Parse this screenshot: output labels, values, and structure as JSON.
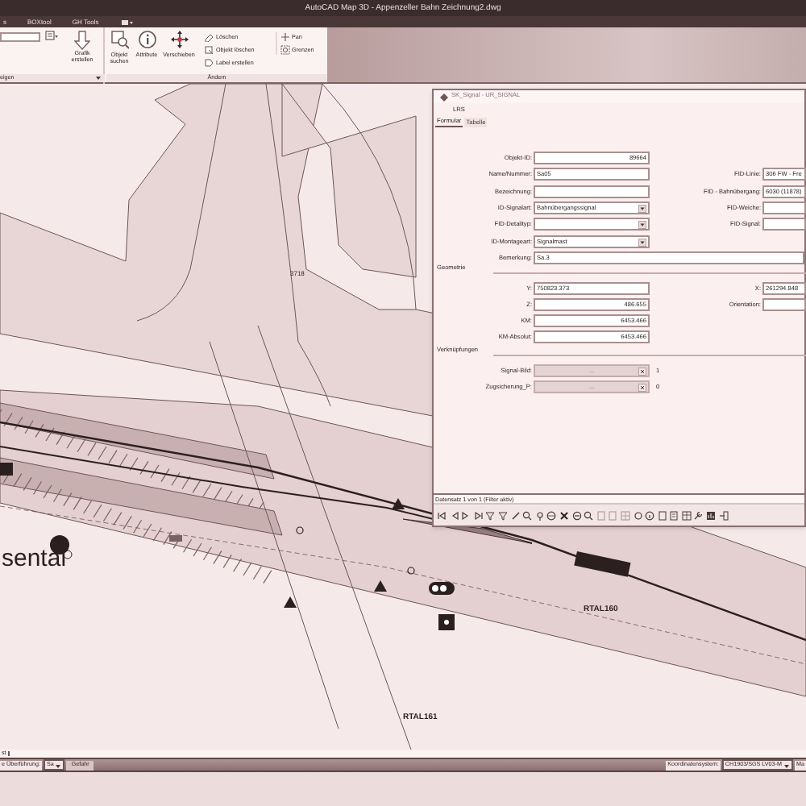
{
  "window": {
    "title": "AutoCAD Map 3D - Appenzeller Bahn   Zeichnung2.dwg"
  },
  "ribbon_tabs": [
    "s",
    "BOXtool",
    "GH Tools"
  ],
  "ribbon": {
    "panels": [
      {
        "title": "eigen",
        "buttons": [
          {
            "label": "Grafik erstellen"
          }
        ]
      },
      {
        "title": "Ändern",
        "buttons": [
          {
            "label": "Objekt suchen"
          },
          {
            "label": "Attribute"
          },
          {
            "label": "Verschieben"
          }
        ],
        "small_buttons": [
          {
            "label": "Löschen"
          },
          {
            "label": "Objekt löschen"
          },
          {
            "label": "Label erstellen"
          }
        ],
        "view_buttons": [
          {
            "label": "Pan"
          },
          {
            "label": "Grenzen"
          }
        ]
      }
    ]
  },
  "map": {
    "labels": [
      {
        "text": "3718"
      },
      {
        "text": "sental"
      },
      {
        "text": "RTAL160"
      },
      {
        "text": "RTAL161"
      }
    ]
  },
  "dialog": {
    "title": "SK_Signal - UR_SIGNAL",
    "heading": "LRS",
    "tabs": [
      {
        "label": "Formular",
        "selected": true
      },
      {
        "label": "Tabelle",
        "selected": false
      }
    ],
    "fields": [
      {
        "label": "Objekt-ID:",
        "value": "89664",
        "kind": "number"
      },
      {
        "label": "Name/Nummer:",
        "value": "Sa05",
        "kind": "text"
      },
      {
        "label": "Bezeichnung:",
        "kind": "text"
      },
      {
        "label": "ID-Signalart:",
        "value": "Bahnübergangssignal",
        "kind": "dropdown"
      },
      {
        "label": "FID-Detailtyp:",
        "kind": "dropdown"
      },
      {
        "label": "ID-Montageart:",
        "value": "Signalmast",
        "kind": "dropdown"
      }
    ],
    "remark": {
      "label": "Bemerkung:",
      "value": "Sa.3"
    },
    "right_fields": [
      {
        "label": "FID-Linie:",
        "value": "306 FW - Fre"
      },
      {
        "label": "FID - Bahnübergang:",
        "value": "6030 (11878)"
      },
      {
        "label": "FID-Weiche:"
      },
      {
        "label": "FID-Signal:"
      }
    ],
    "geometry": {
      "title": "Geometrie",
      "fields": [
        {
          "label": "Y:",
          "value": "750823.373",
          "kind": "text"
        },
        {
          "label": "Z:",
          "value": "486.655",
          "kind": "number"
        },
        {
          "label": "KM:",
          "value": "6453.466",
          "kind": "number"
        },
        {
          "label": "KM-Absolut:",
          "value": "6453.466",
          "kind": "number"
        }
      ],
      "right_fields": [
        {
          "label": "X:",
          "value": "261294.848"
        },
        {
          "label": "Orientation:"
        }
      ]
    },
    "links": {
      "title": "Verknüpfungen",
      "fields": [
        {
          "label": "Signal-Bild:",
          "value": "...",
          "count": "1"
        },
        {
          "label": "Zugsicherung_P:",
          "value": "...",
          "count": "0"
        }
      ]
    },
    "record_status": "Datensatz 1 von 1 (Filter aktiv)"
  },
  "layout_tab": "st",
  "status_bar": {
    "left": [
      {
        "text": "e Überführung:",
        "kind": "label"
      },
      {
        "text": "Sa",
        "kind": "dropdown"
      },
      {
        "text": "Gefahr",
        "kind": "field"
      }
    ],
    "right": [
      {
        "text": "Koordinatensystem:",
        "kind": "label"
      },
      {
        "text": "CH1903/SGS LV03-M",
        "kind": "dropdown"
      },
      {
        "text": "Ma",
        "kind": "label"
      }
    ]
  }
}
